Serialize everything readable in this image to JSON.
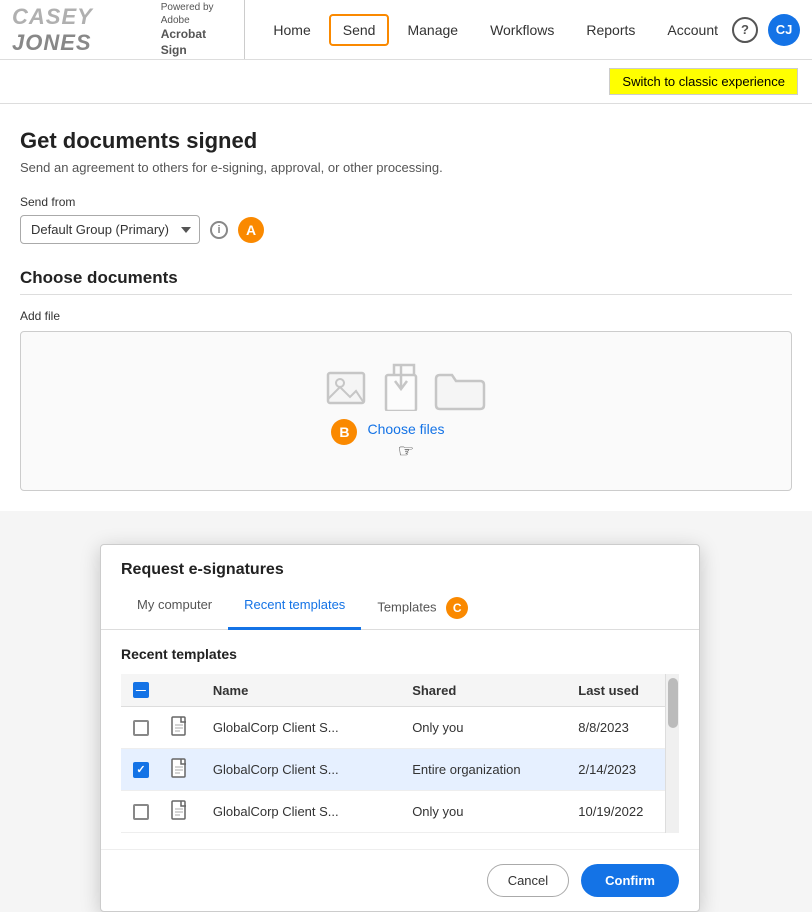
{
  "nav": {
    "logo_name": "CASEY JONES",
    "powered_by_line1": "Powered by Adobe",
    "powered_by_line2": "Acrobat Sign",
    "links": [
      {
        "label": "Home",
        "active": false
      },
      {
        "label": "Send",
        "active": true
      },
      {
        "label": "Manage",
        "active": false
      },
      {
        "label": "Workflows",
        "active": false
      },
      {
        "label": "Reports",
        "active": false
      },
      {
        "label": "Account",
        "active": false
      }
    ],
    "help_label": "?",
    "avatar_label": "CJ"
  },
  "switch_btn": "Switch to classic experience",
  "page": {
    "title": "Get documents signed",
    "subtitle": "Send an agreement to others for e-signing, approval, or other processing.",
    "send_from_label": "Send from",
    "send_from_value": "Default Group (Primary)",
    "step_a_label": "A",
    "choose_documents_title": "Choose documents",
    "add_file_label": "Add file",
    "choose_files_link": "Choose files",
    "step_b_label": "B"
  },
  "modal": {
    "title": "Request e-signatures",
    "tabs": [
      {
        "label": "My computer",
        "active": false
      },
      {
        "label": "Recent templates",
        "active": true
      },
      {
        "label": "Templates",
        "active": false
      }
    ],
    "step_c_label": "C",
    "recent_templates_title": "Recent templates",
    "table": {
      "headers": [
        "",
        "",
        "Name",
        "Shared",
        "Last used"
      ],
      "rows": [
        {
          "checked": false,
          "name": "GlobalCorp Client S...",
          "shared": "Only you",
          "last_used": "8/8/2023",
          "selected": false
        },
        {
          "checked": true,
          "name": "GlobalCorp Client S...",
          "shared": "Entire organization",
          "last_used": "2/14/2023",
          "selected": true
        },
        {
          "checked": false,
          "name": "GlobalCorp Client S...",
          "shared": "Only you",
          "last_used": "10/19/2022",
          "selected": false
        }
      ]
    },
    "cancel_label": "Cancel",
    "confirm_label": "Confirm"
  }
}
